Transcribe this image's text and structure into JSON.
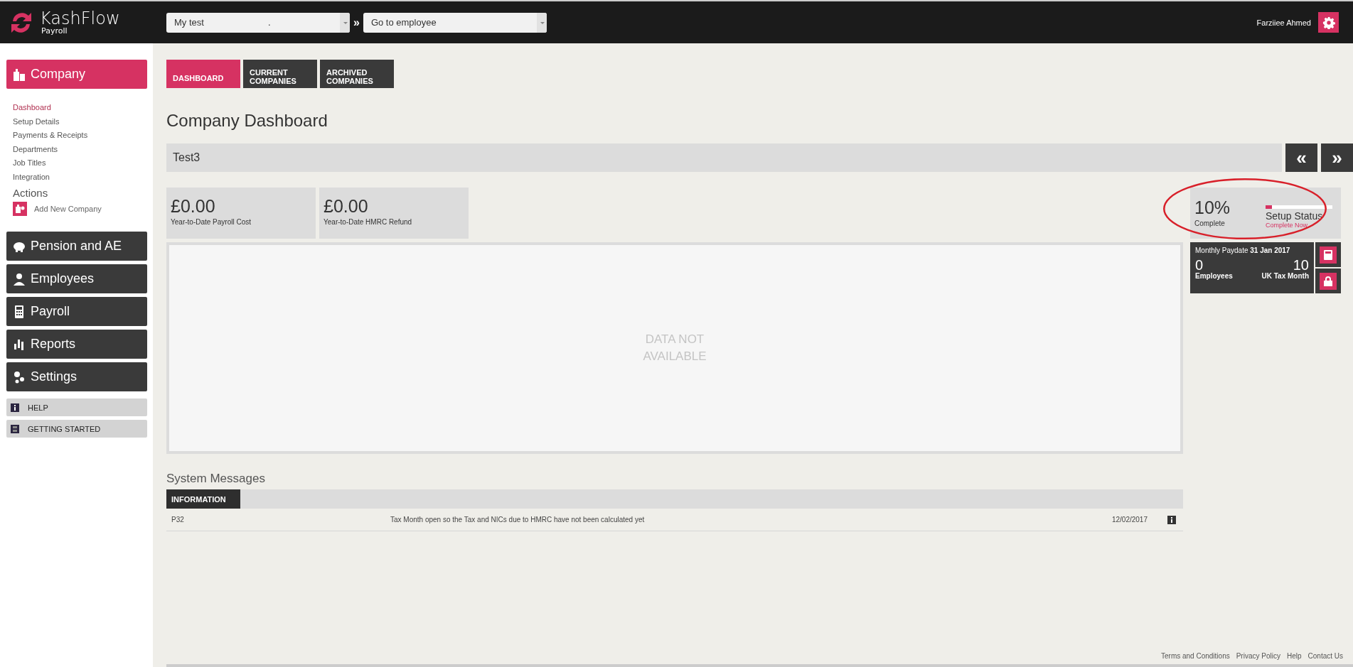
{
  "header": {
    "logo": {
      "name": "KashFlow",
      "sub": "Payroll"
    },
    "company_select": {
      "value": "My test",
      "extra": "."
    },
    "separator": "»",
    "employee_select": {
      "value": "Go to employee"
    },
    "user": "Farziiee Ahmed"
  },
  "sidebar": {
    "sections": [
      {
        "label": "Company",
        "selected": true,
        "children": [
          {
            "label": "Dashboard",
            "selected": true
          },
          {
            "label": "Setup Details",
            "selected": false
          },
          {
            "label": "Payments & Receipts",
            "selected": false
          },
          {
            "label": "Departments",
            "selected": false
          },
          {
            "label": "Job Titles",
            "selected": false
          },
          {
            "label": "Integration",
            "selected": false
          }
        ],
        "actions_title": "Actions",
        "actions": [
          {
            "label": "Add New Company"
          }
        ]
      },
      {
        "label": "Pension and AE",
        "selected": false
      },
      {
        "label": "Employees",
        "selected": false
      },
      {
        "label": "Payroll",
        "selected": false
      },
      {
        "label": "Reports",
        "selected": false
      },
      {
        "label": "Settings",
        "selected": false
      }
    ],
    "links": [
      {
        "label": "HELP"
      },
      {
        "label": "GETTING STARTED"
      }
    ]
  },
  "tabs": [
    {
      "label": "DASHBOARD",
      "selected": true
    },
    {
      "label": "CURRENT COMPANIES",
      "selected": false
    },
    {
      "label": "ARCHIVED COMPANIES",
      "selected": false
    }
  ],
  "page_title": "Company Dashboard",
  "company_bar": {
    "name": "Test3",
    "prev": "«",
    "next": "»"
  },
  "stats": [
    {
      "value": "£0.00",
      "label": "Year-to-Date Payroll Cost"
    },
    {
      "value": "£0.00",
      "label": "Year-to-Date HMRC Refund"
    }
  ],
  "chart_placeholder": "DATA NOT AVAILABLE",
  "setup_status": {
    "percent": "10%",
    "caption": "Complete",
    "level": 0.1,
    "title": "Setup Status",
    "link": "Complete Now",
    "highlighted": true
  },
  "paydate": {
    "label": "Monthly Paydate",
    "date": "31 Jan 2017",
    "employees": "0",
    "employees_label": "Employees",
    "tax_month": "10",
    "tax_month_label": "UK Tax Month"
  },
  "system_messages": {
    "title": "System Messages",
    "tab": "INFORMATION",
    "rows": [
      {
        "code": "P32",
        "message": "Tax Month open so the Tax and NICs due to HMRC have not been calculated yet",
        "date": "12/02/2017"
      }
    ]
  },
  "footer": [
    "Terms and Conditions",
    "Privacy Policy",
    "Help",
    "Contact Us"
  ]
}
